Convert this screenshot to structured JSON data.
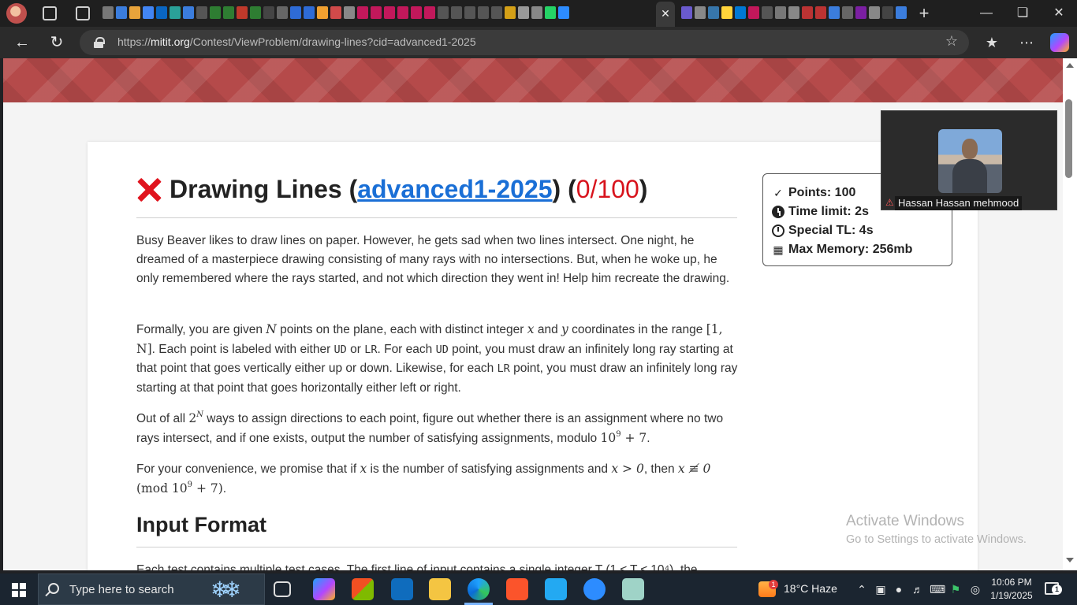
{
  "browser": {
    "url_domain": "mitit.org",
    "url_path": "/Contest/ViewProblem/drawing-lines?cid=advanced1-2025",
    "url_scheme": "https://",
    "active_tab_close": "✕",
    "new_tab": "+"
  },
  "problem": {
    "title": "Drawing Lines",
    "contest_link": "advanced1-2025",
    "score": "0/100",
    "p1": "Busy Beaver likes to draw lines on paper. However, he gets sad when two lines intersect. One night, he dreamed of a masterpiece drawing consisting of many rays with no intersections. But, when he woke up, he only remembered where the rays started, and not which direction they went in! Help him recreate the drawing.",
    "p2": {
      "a": "Formally, you are given ",
      "N": "N",
      "b": " points on the plane, each with distinct integer ",
      "x": "x",
      "c": " and ",
      "y": "y",
      "d": " coordinates in the range ",
      "range": "[1, N]",
      "e": ". Each point is labeled with either ",
      "ud": "UD",
      "f": " or ",
      "lr": "LR",
      "g": ". For each ",
      "ud2": "UD",
      "h": " point, you must draw an infinitely long ray starting at that point that goes vertically either up or down. Likewise, for each ",
      "lr2": "LR",
      "i": " point, you must draw an infinitely long ray starting at that point that goes horizontally either left or right."
    },
    "p3": {
      "a": "Out of all ",
      "base": "2",
      "exp": "N",
      "b": " ways to assign directions to each point, figure out whether there is an assignment where no two rays intersect, and if one exists, output the number of satisfying assignments, modulo ",
      "mod_base": "10",
      "mod_exp": "9",
      "mod_tail": " + 7",
      "c": "."
    },
    "p4": {
      "a": "For your convenience, we promise that if ",
      "x": "x",
      "b": " is the number of satisfying assignments and ",
      "cond1": "x > 0",
      "c": ", then ",
      "cond2": "x ≢ 0",
      "mod_open": "(mod 10",
      "mod_exp": "9",
      "mod_close": " + 7)",
      "d": "."
    },
    "input_heading": "Input Format",
    "input_partial": "Each test contains multiple test cases. The first line of input contains a single integer T (1 ≤ T ≤ 10⁴), the"
  },
  "info_box": {
    "points": "Points: 100",
    "time_limit": "Time limit: 2s",
    "special_tl": "Special TL: 4s",
    "max_memory": "Max Memory: 256mb"
  },
  "video": {
    "participant_name": "Hassan Hassan mehmood"
  },
  "watermark": {
    "line1": "Activate Windows",
    "line2": "Go to Settings to activate Windows."
  },
  "taskbar": {
    "search_placeholder": "Type here to search",
    "weather_badge": "1",
    "weather": "18°C  Haze",
    "time": "10:06 PM",
    "date": "1/19/2025",
    "notification_count": "1"
  },
  "colors": {
    "banner": "#b54a4a",
    "link": "#1a6fd6",
    "score_red": "#d8131c",
    "x_mark": "#e0141e"
  }
}
